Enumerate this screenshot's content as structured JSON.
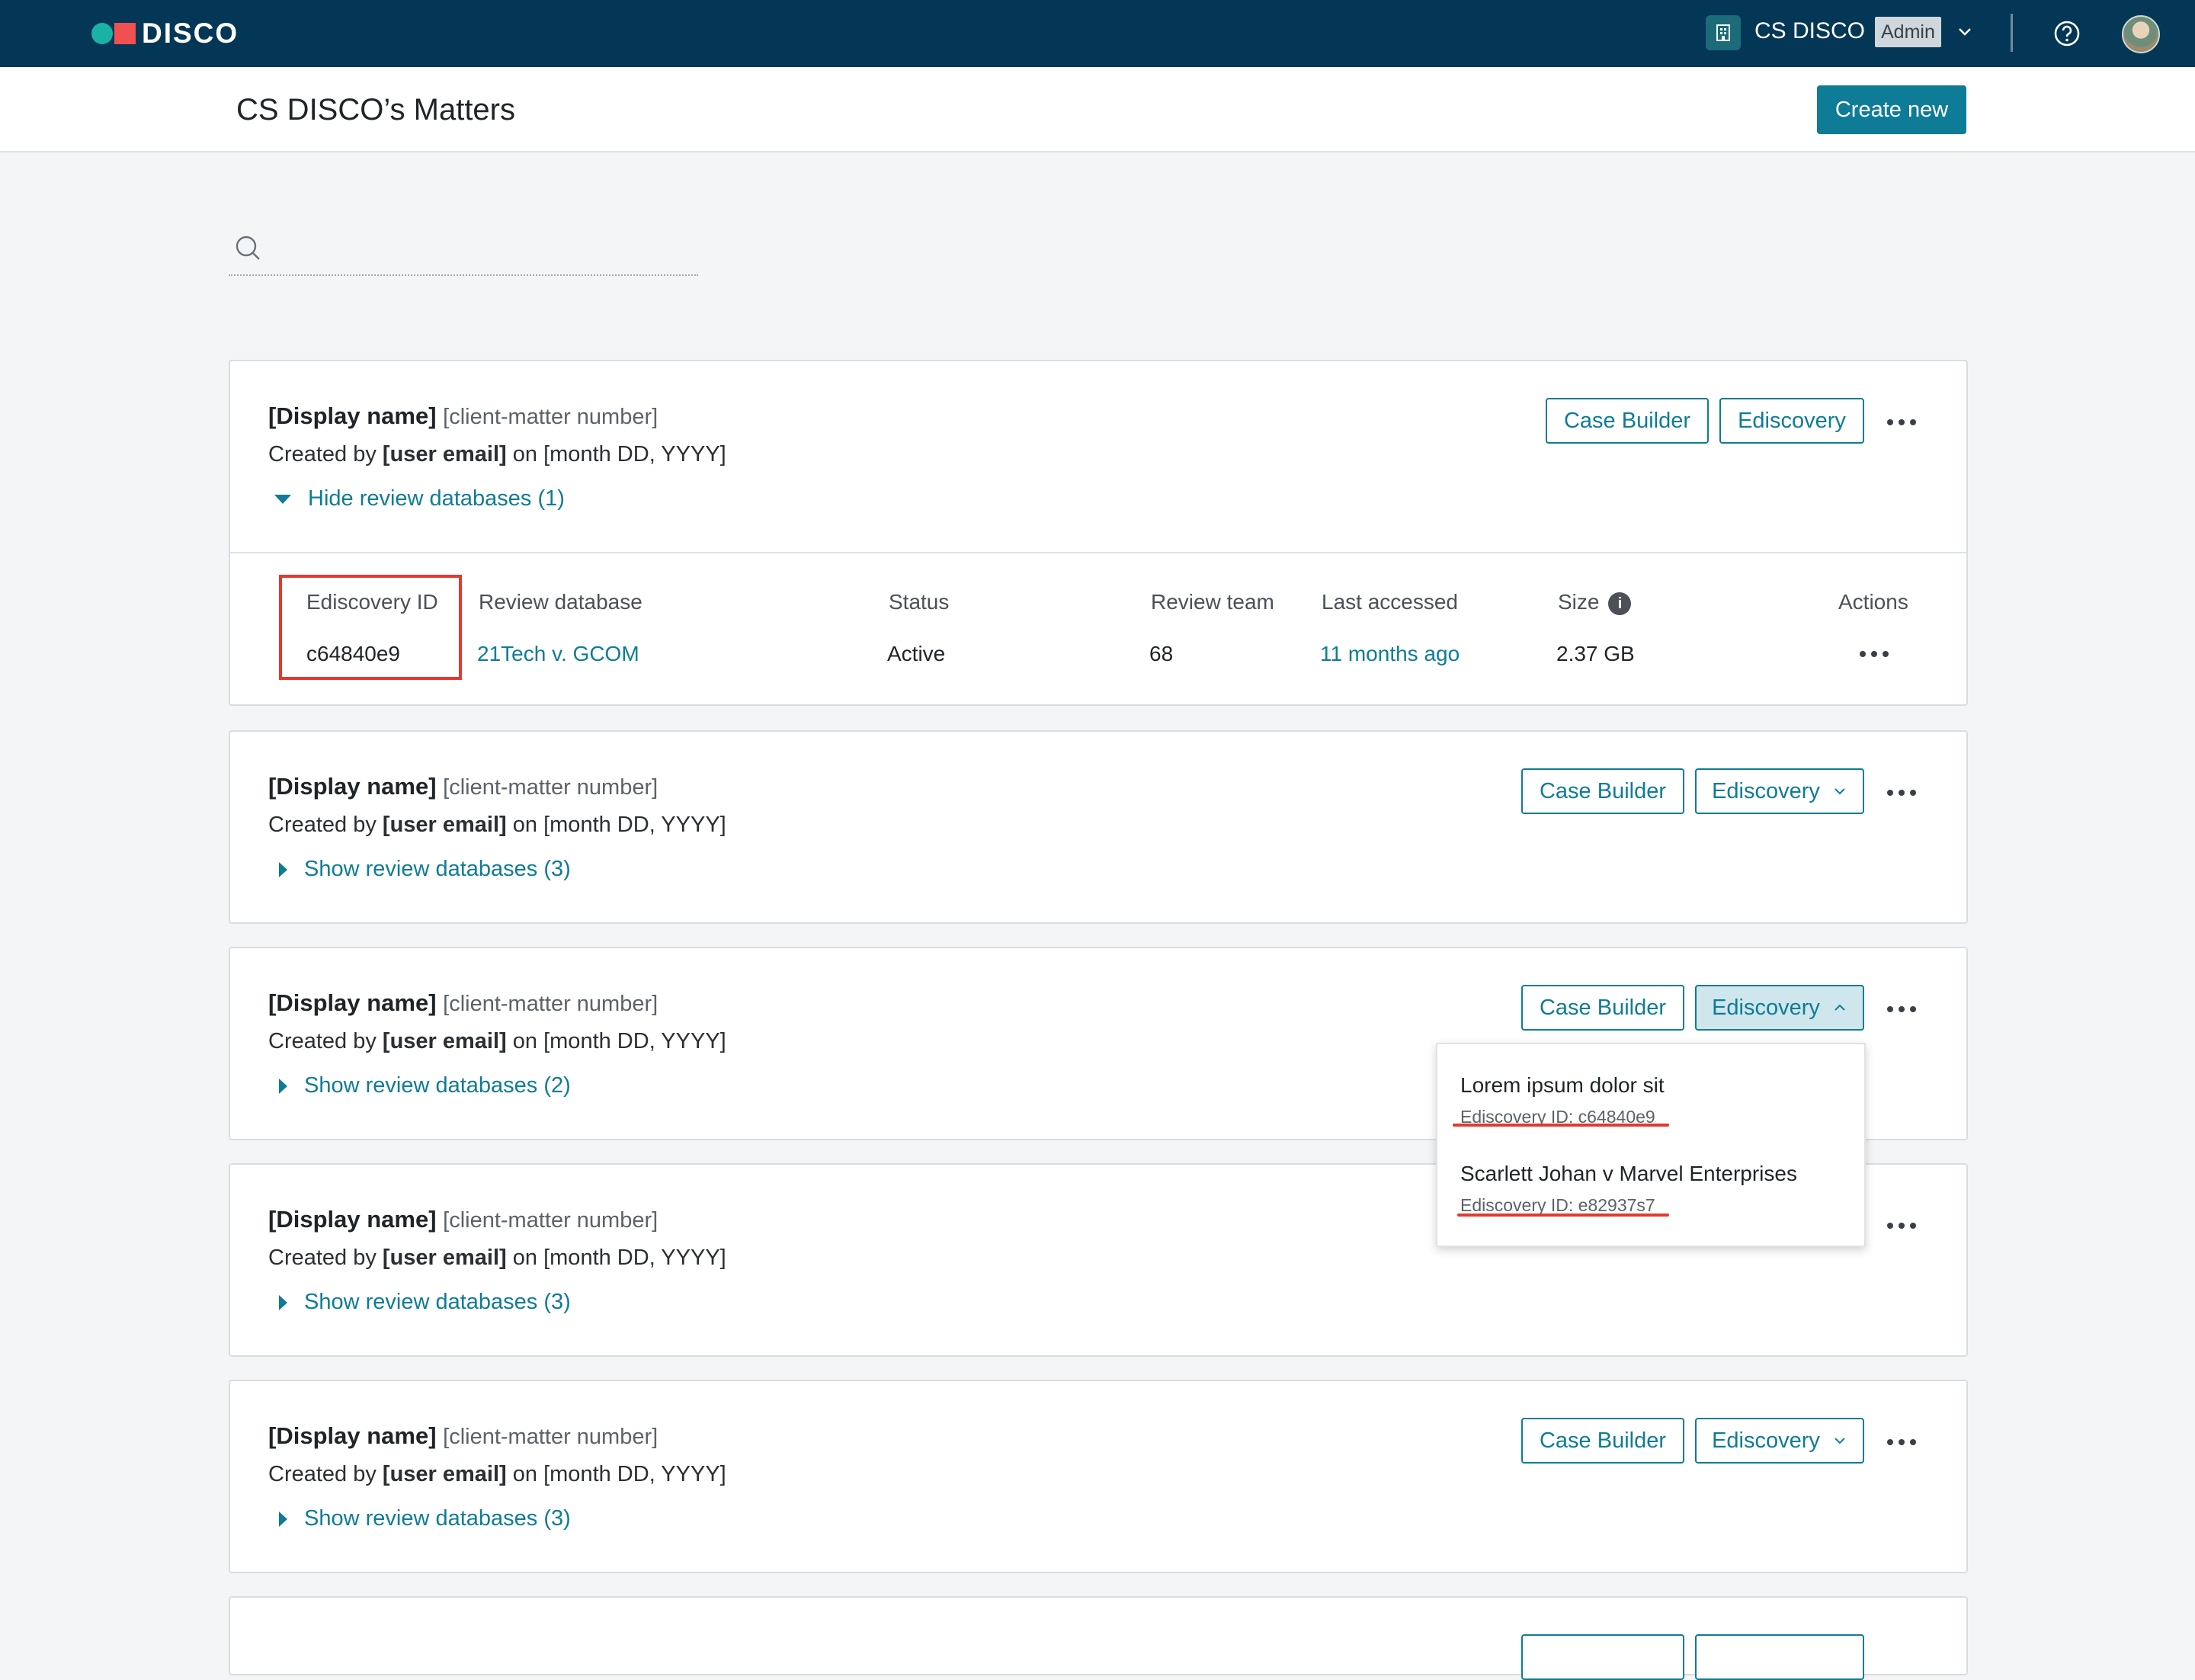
{
  "app": {
    "brand": "DISCO",
    "org_name": "CS DISCO",
    "role_badge": "Admin"
  },
  "header": {
    "title": "CS DISCO’s Matters",
    "create_label": "Create new"
  },
  "search": {
    "placeholder": ""
  },
  "buttons": {
    "case_builder": "Case Builder",
    "ediscovery": "Ediscovery"
  },
  "matters": [
    {
      "display_name": "[Display name]",
      "client_matter": "[client-matter number]",
      "created_prefix": "Created by",
      "user_email": "[user email]",
      "created_on": "on [month DD, YYYY]",
      "toggle": "Hide review databases (1)",
      "expanded": true
    },
    {
      "display_name": "[Display name]",
      "client_matter": "[client-matter number]",
      "created_prefix": "Created by",
      "user_email": "[user email]",
      "created_on": "on [month DD, YYYY]",
      "toggle": "Show review databases (3)"
    },
    {
      "display_name": "[Display name]",
      "client_matter": "[client-matter number]",
      "created_prefix": "Created by",
      "user_email": "[user email]",
      "created_on": "on [month DD, YYYY]",
      "toggle": "Show review databases (2)"
    },
    {
      "display_name": "[Display name]",
      "client_matter": "[client-matter number]",
      "created_prefix": "Created by",
      "user_email": "[user email]",
      "created_on": "on [month DD, YYYY]",
      "toggle": "Show review databases (3)"
    },
    {
      "display_name": "[Display name]",
      "client_matter": "[client-matter number]",
      "created_prefix": "Created by",
      "user_email": "[user email]",
      "created_on": "on [month DD, YYYY]",
      "toggle": "Show review databases (3)"
    }
  ],
  "review_table": {
    "headers": [
      "Ediscovery ID",
      "Review database",
      "Status",
      "Review team",
      "Last accessed",
      "Size",
      "Actions"
    ],
    "row": {
      "ediscovery_id": "c64840e9",
      "database": "21Tech v. GCOM",
      "status": "Active",
      "team": "68",
      "last_accessed": "11 months ago",
      "size": "2.37 GB"
    }
  },
  "ediscovery_dropdown": [
    {
      "title": "Lorem ipsum dolor sit",
      "id_label": "Ediscovery ID: c64840e9"
    },
    {
      "title": "Scarlett Johan v Marvel Enterprises",
      "id_label": "Ediscovery ID: e82937s7"
    }
  ],
  "colors": {
    "nav_bg": "#043756",
    "accent": "#0e7c97",
    "highlight": "#e23a2f"
  }
}
